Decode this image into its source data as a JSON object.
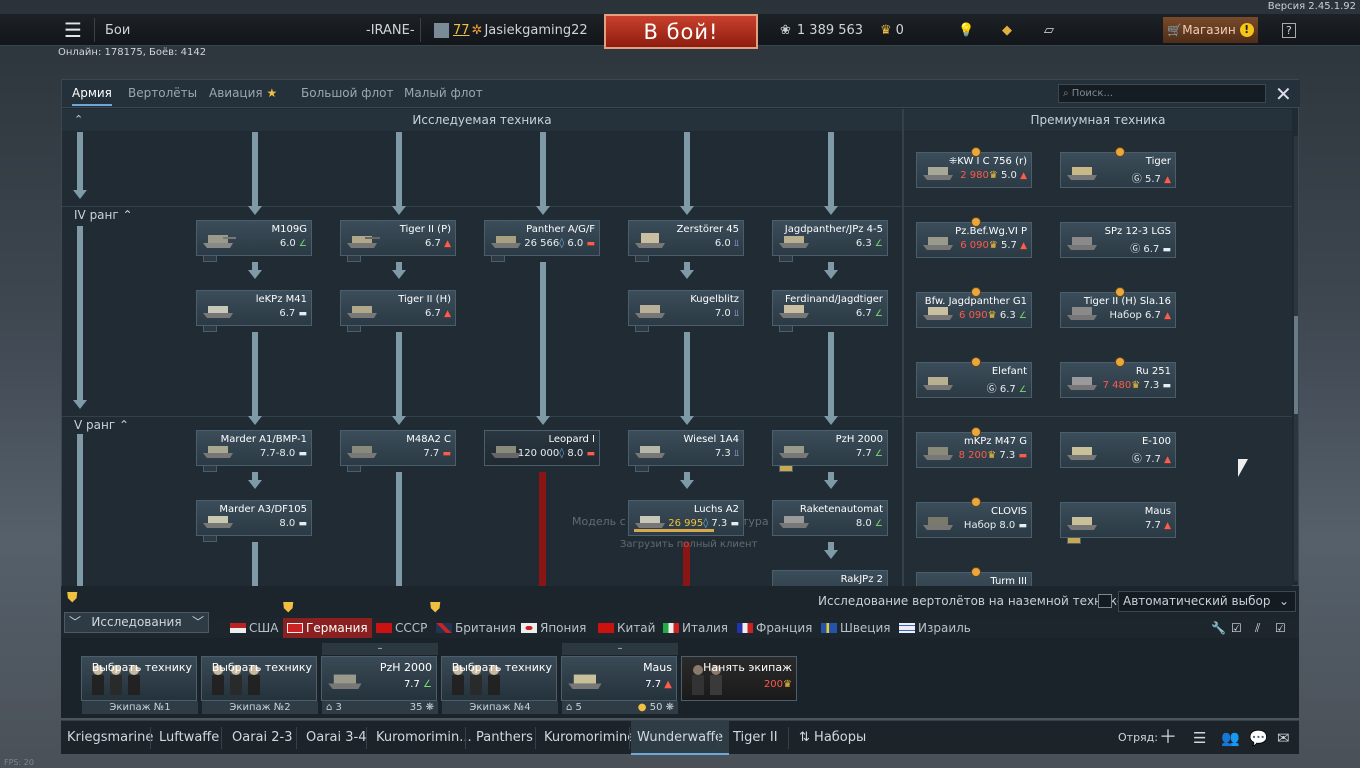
{
  "version": "Версия 2.45.1.92",
  "topbar": {
    "battles": "Бои",
    "squad": "-IRANE-",
    "level": "77",
    "nickname": "Jasiekgaming22",
    "battle_button": "В бой!",
    "silver": "1 389 563",
    "gold": "0",
    "shop": "Магазин",
    "shop_badge": "!",
    "help": "?"
  },
  "online": "Онлайн: 178175, Боёв: 4142",
  "tabs": [
    "Армия",
    "Вертолёты",
    "Авиация",
    "Большой флот",
    "Малый флот"
  ],
  "search_placeholder": "Поиск...",
  "headers": {
    "researched": "Исследуемая техника",
    "premium": "Премиумная техника"
  },
  "ranks": [
    "IV ранг",
    "V ранг"
  ],
  "tree": [
    {
      "name": "M109G",
      "stat": "6.0"
    },
    {
      "name": "Tiger II (P)",
      "stat": "6.7"
    },
    {
      "name": "Panther A/G/F",
      "stat": "26 566",
      "stat2": "6.0"
    },
    {
      "name": "Zerstörer 45",
      "stat": "6.0"
    },
    {
      "name": "Jagdpanther/JPz 4-5",
      "stat": "6.3"
    },
    {
      "name": "leKPz M41",
      "stat": "6.7"
    },
    {
      "name": "Tiger II (H)",
      "stat": "6.7"
    },
    {
      "name": "Kugelblitz",
      "stat": "7.0"
    },
    {
      "name": "Ferdinand/Jagdtiger",
      "stat": "6.7"
    },
    {
      "name": "Marder A1/BMP-1",
      "stat": "7.7-8.0"
    },
    {
      "name": "M48A2 C",
      "stat": "7.7"
    },
    {
      "name": "Leopard I",
      "stat": "120 000",
      "stat2": "8.0"
    },
    {
      "name": "Wiesel 1A4",
      "stat": "7.3"
    },
    {
      "name": "PzH 2000",
      "stat": "7.7"
    },
    {
      "name": "Marder A3/DF105",
      "stat": "8.0"
    },
    {
      "name": "Luchs A2",
      "stat": "26 995",
      "stat2": "7.3"
    },
    {
      "name": "Raketenautomat",
      "stat": "8.0"
    },
    {
      "name": "RakJPz 2",
      "stat": ""
    }
  ],
  "premium": [
    {
      "name": "⁜KW I C 756 (r)",
      "price": "2 980",
      "stat": "5.0"
    },
    {
      "name": "Tiger",
      "price": "",
      "stat": "5.7"
    },
    {
      "name": "Pz.Bef.Wg.VI P",
      "price": "6 090",
      "stat": "5.7"
    },
    {
      "name": "SPz 12-3 LGS",
      "price": "",
      "stat": "6.7"
    },
    {
      "name": "Bfw. Jagdpanther G1",
      "price": "6 090",
      "stat": "6.3"
    },
    {
      "name": "Tiger II (H) Sla.16",
      "price": "Набор",
      "stat": "6.7"
    },
    {
      "name": "Elefant",
      "price": "",
      "stat": "6.7"
    },
    {
      "name": "Ru 251",
      "price": "7 480",
      "stat": "7.3"
    },
    {
      "name": "mKPz M47 G",
      "price": "8 200",
      "stat": "7.3"
    },
    {
      "name": "E-100",
      "price": "",
      "stat": "7.7"
    },
    {
      "name": "CLOVIS",
      "price": "Набор",
      "stat": "8.0"
    },
    {
      "name": "Maus",
      "price": "",
      "stat": "7.7"
    },
    {
      "name": "Turm III",
      "price": "",
      "stat": ""
    }
  ],
  "overlay": {
    "model": "Модель с",
    "model2": "тура",
    "download": "Загрузить полный клиент"
  },
  "research_tab": "Исследования",
  "heli_label": "Исследование вертолётов на наземной технике",
  "auto_select": "Автоматический выбор",
  "nations": [
    "США",
    "Германия",
    "СССР",
    "Британия",
    "Япония",
    "Китай",
    "Италия",
    "Франция",
    "Швеция",
    "Израиль"
  ],
  "crew": [
    {
      "name": "Выбрать технику",
      "label": "Экипаж №1"
    },
    {
      "name": "Выбрать технику",
      "label": "Экипаж №2"
    },
    {
      "name": "PzH 2000",
      "stat": "7.7",
      "label_left": "3",
      "label_right": "35",
      "top": "–"
    },
    {
      "name": "Выбрать технику",
      "label": "Экипаж №4"
    },
    {
      "name": "Maus",
      "stat": "7.7",
      "label_left": "5",
      "label_right": "50",
      "top": "–"
    },
    {
      "name": "Нанять экипаж",
      "stat": "200"
    }
  ],
  "presets": [
    "Kriegsmarine",
    "Luftwaffe",
    "Oarai 2-3",
    "Oarai 3-4",
    "Kuromorimin...",
    "Panthers",
    "Kuromorimine",
    "Wunderwaffe",
    "Tiger II",
    "Наборы"
  ],
  "squad_label": "Отряд:",
  "fps": "FPS: 20"
}
